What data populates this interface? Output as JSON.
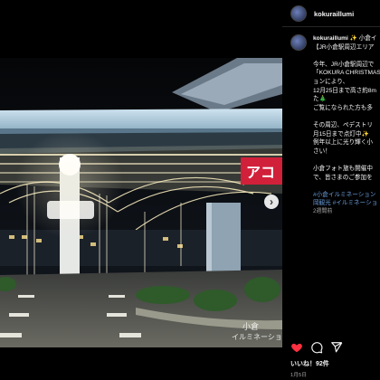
{
  "account": {
    "username": "kokuraillumi"
  },
  "caption": {
    "username": "kokuraillumi",
    "line1": "✨ 小倉イ",
    "line2": "【JR小倉駅周辺エリア",
    "line3": "今年、JR小倉駅周辺で",
    "line4": "「KOKURA CHRISTMAS",
    "line5": "ョンにより、",
    "line6": "12月25日まで高さ約8m",
    "line7": "た🎄",
    "line8": "ご覧になられた方も多",
    "line9": "その周辺、ペデストリ",
    "line10": "月15日まで点灯中✨",
    "line11": "例年以上に光り輝く小",
    "line12": "さい！",
    "line13": "小倉フォト旅も開催中",
    "line14": "で、皆さまのご参加を",
    "hashtag1": "#小倉イルミネーション",
    "hashtag2": "岡観光 #イルミネーショ",
    "ago": "2週間前"
  },
  "watermark": {
    "line1": "小倉",
    "line2": "イルミネーション"
  },
  "store_sign": "アコ",
  "likes": "いいね！92件",
  "date": "1月5日",
  "icons": {
    "like": "heart-icon",
    "comment": "comment-icon",
    "share": "share-icon",
    "next": "chevron-right-icon"
  }
}
